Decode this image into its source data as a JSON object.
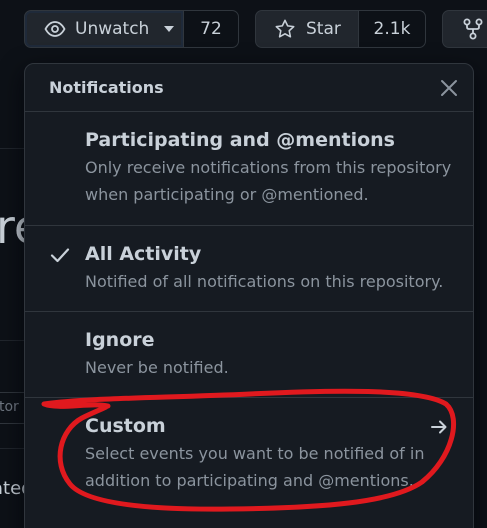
{
  "toolbar": {
    "unwatch_label": "Unwatch",
    "watch_count": "72",
    "star_label": "Star",
    "star_count": "2.1k"
  },
  "background": {
    "heading_fragment": "re",
    "input_fragment": "tor",
    "text_fragment": "ated"
  },
  "notifications": {
    "title": "Notifications",
    "options": [
      {
        "title": "Participating and @mentions",
        "description": "Only receive notifications from this repository when participating or @mentioned.",
        "selected": false
      },
      {
        "title": "All Activity",
        "description": "Notified of all notifications on this repository.",
        "selected": true
      },
      {
        "title": "Ignore",
        "description": "Never be notified.",
        "selected": false
      },
      {
        "title": "Custom",
        "description": "Select events you want to be notified of in addition to participating and @mentions.",
        "selected": false
      }
    ]
  },
  "colors": {
    "background": "#0d1117",
    "menu_background": "#161b22",
    "border": "#30363d",
    "annotation": "#e0191e"
  }
}
